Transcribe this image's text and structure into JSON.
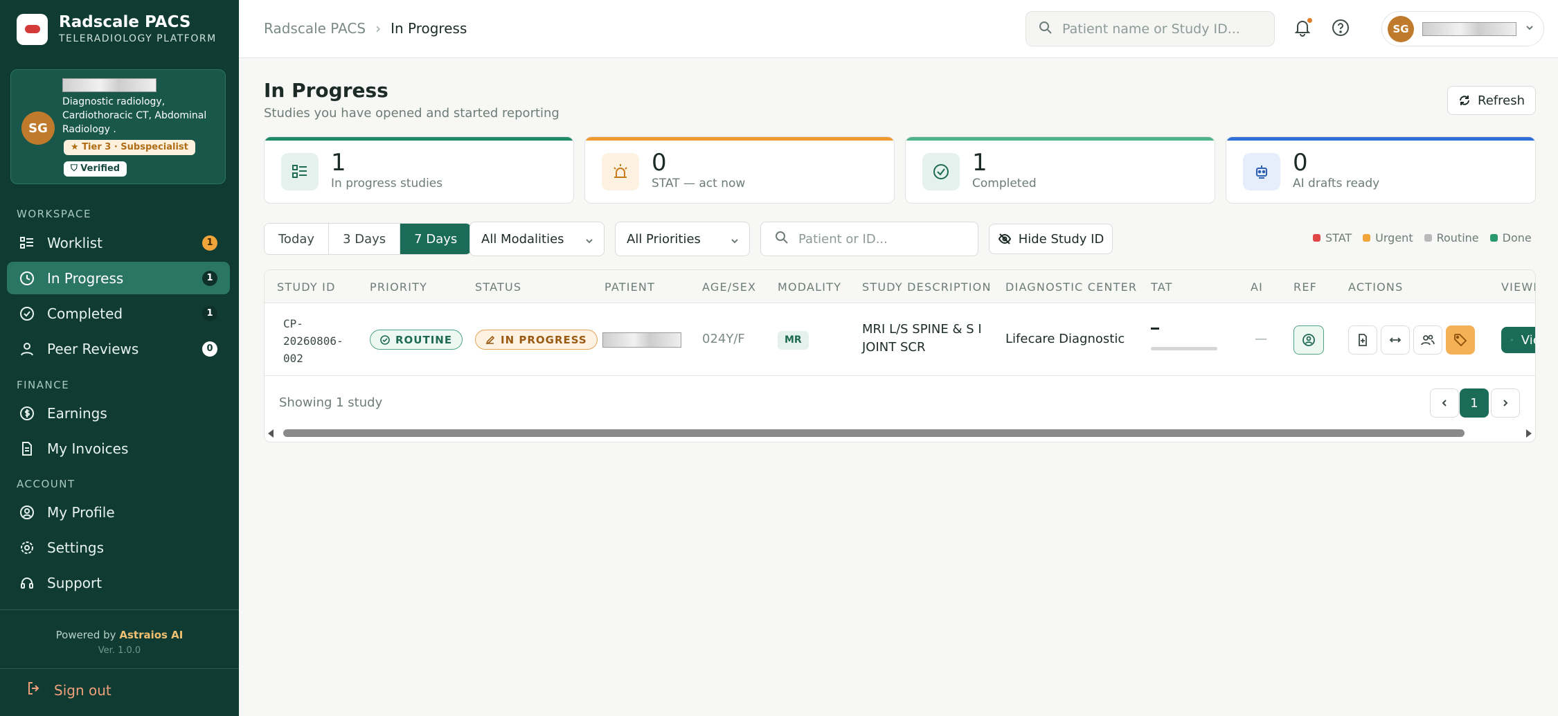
{
  "brand": {
    "name": "Radscale PACS",
    "subtitle": "TELERADIOLOGY PLATFORM"
  },
  "profile": {
    "initials": "SG",
    "specialty": "Diagnostic radiology, Cardiothoracic CT, Abdominal Radiology .",
    "tier": "Tier 3 · Subspecialist",
    "verified": "Verified"
  },
  "sidebar": {
    "workspace_label": "WORKSPACE",
    "finance_label": "FINANCE",
    "account_label": "ACCOUNT",
    "workspace": [
      {
        "label": "Worklist",
        "count": "1"
      },
      {
        "label": "In Progress",
        "count": "1"
      },
      {
        "label": "Completed",
        "count": "1"
      },
      {
        "label": "Peer Reviews",
        "count": "0"
      }
    ],
    "finance": [
      {
        "label": "Earnings"
      },
      {
        "label": "My Invoices"
      }
    ],
    "account": [
      {
        "label": "My Profile"
      },
      {
        "label": "Settings"
      },
      {
        "label": "Support"
      }
    ],
    "powered_prefix": "Powered by",
    "powered_brand": "Astraios AI",
    "version": "Ver. 1.0.0",
    "signout": "Sign out"
  },
  "topbar": {
    "breadcrumb_root": "Radscale PACS",
    "breadcrumb_current": "In Progress",
    "search_placeholder": "Patient name or Study ID...",
    "user_initials": "SG"
  },
  "page": {
    "title": "In Progress",
    "subtitle": "Studies you have opened and started reporting",
    "refresh": "Refresh"
  },
  "stats": [
    {
      "value": "1",
      "label": "In progress studies",
      "color": "#1f8a6a"
    },
    {
      "value": "0",
      "label": "STAT — act now",
      "color": "#ee9a2e"
    },
    {
      "value": "1",
      "label": "Completed",
      "color": "#4fb28a"
    },
    {
      "value": "0",
      "label": "AI drafts ready",
      "color": "#2f6fd6"
    }
  ],
  "filters": {
    "ranges": [
      "Today",
      "3 Days",
      "7 Days"
    ],
    "active_range": "7 Days",
    "modality": "All Modalities",
    "priority": "All Priorities",
    "search_placeholder": "Patient or ID...",
    "hide_study_id": "Hide Study ID"
  },
  "legend": [
    {
      "label": "STAT",
      "color": "#e04848"
    },
    {
      "label": "Urgent",
      "color": "#f0a43a"
    },
    {
      "label": "Routine",
      "color": "#b9b9b9"
    },
    {
      "label": "Done",
      "color": "#2a9a6e"
    }
  ],
  "table": {
    "columns": [
      "STUDY ID",
      "PRIORITY",
      "STATUS",
      "PATIENT",
      "AGE/SEX",
      "MODALITY",
      "STUDY DESCRIPTION",
      "DIAGNOSTIC CENTER",
      "TAT",
      "AI",
      "REF",
      "ACTIONS",
      "VIEWER"
    ],
    "rows": [
      {
        "study_id": "CP-20260806-002",
        "study_id_lines": [
          "CP-",
          "20260806-",
          "002"
        ],
        "priority": "ROUTINE",
        "status": "IN PROGRESS",
        "age_sex": "024Y/F",
        "modality": "MR",
        "description": "MRI L/S SPINE & S I JOINT SCR",
        "center": "Lifecare Diagnostic",
        "ai": "—",
        "viewer": "Viewer"
      }
    ],
    "showing": "Showing 1 study",
    "page": "1"
  }
}
